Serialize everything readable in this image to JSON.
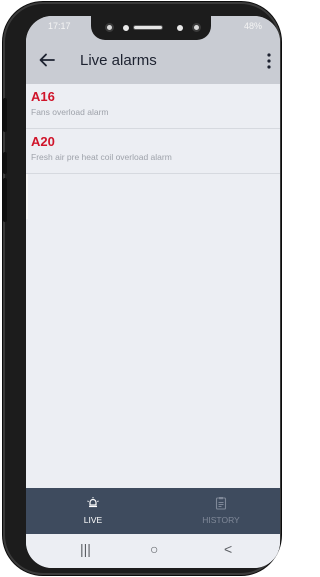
{
  "status_bar": {
    "time": "17:17",
    "battery": "48%"
  },
  "app_bar": {
    "title": "Live alarms",
    "back_icon": "arrow-left-icon",
    "menu_icon": "more-vert-icon"
  },
  "alarms": [
    {
      "code": "A16",
      "description": "Fans overload alarm"
    },
    {
      "code": "A20",
      "description": "Fresh air pre heat coil overload alarm"
    }
  ],
  "bottom_nav": {
    "items": [
      {
        "label": "LIVE",
        "icon": "alarm-bell-icon",
        "active": true
      },
      {
        "label": "HISTORY",
        "icon": "clipboard-icon",
        "active": false
      }
    ]
  },
  "system_nav": {
    "recent": "|||",
    "home": "○",
    "back": "<"
  },
  "colors": {
    "alarm_code": "#d0142a",
    "app_bar": "#c9ccd3",
    "bottom_nav": "#3e4b5e",
    "screen_bg": "#eceef3"
  }
}
